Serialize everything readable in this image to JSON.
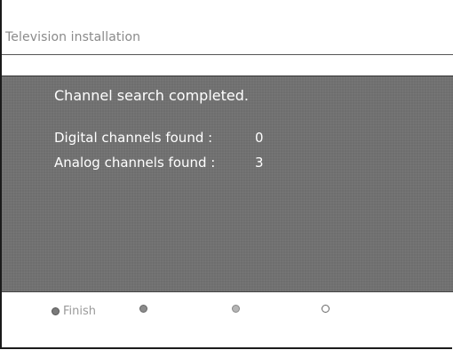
{
  "header": {
    "title": "Television installation"
  },
  "panel": {
    "message": "Channel search completed.",
    "digital": {
      "label": "Digital channels found :",
      "value": "0"
    },
    "analog": {
      "label": "Analog channels found :",
      "value": "3"
    }
  },
  "footer": {
    "buttons": [
      {
        "color": "red",
        "icon": "red-key-icon",
        "label": "Finish"
      },
      {
        "color": "green",
        "icon": "green-key-icon",
        "label": ""
      },
      {
        "color": "yellow",
        "icon": "yellow-key-icon",
        "label": ""
      },
      {
        "color": "blue",
        "icon": "blue-key-icon",
        "label": ""
      }
    ]
  }
}
